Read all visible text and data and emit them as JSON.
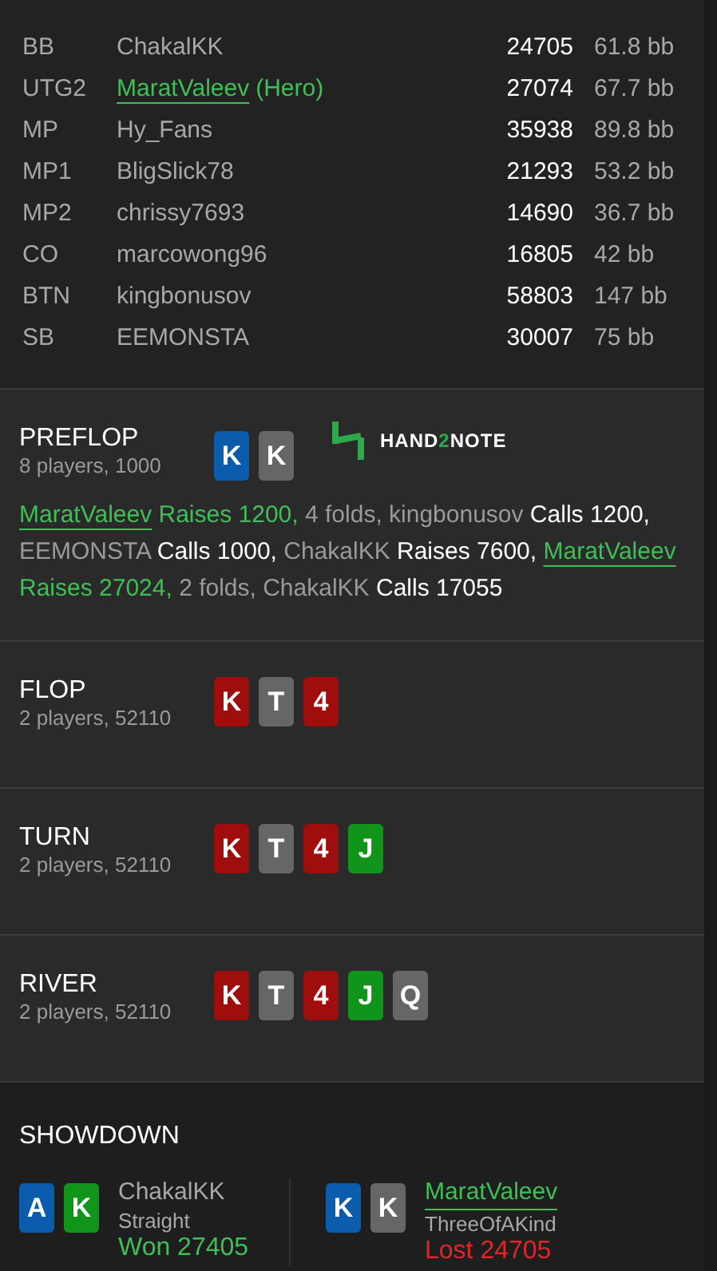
{
  "players": [
    {
      "position": "BB",
      "name": "ChakalKK",
      "hero": false,
      "stack": "24705",
      "bb": "61.8 bb"
    },
    {
      "position": "UTG2",
      "name": "MaratValeev",
      "hero": true,
      "tag": "(Hero)",
      "stack": "27074",
      "bb": "67.7 bb"
    },
    {
      "position": "MP",
      "name": "Hy_Fans",
      "hero": false,
      "stack": "35938",
      "bb": "89.8 bb"
    },
    {
      "position": "MP1",
      "name": "BligSlick78",
      "hero": false,
      "stack": "21293",
      "bb": "53.2 bb"
    },
    {
      "position": "MP2",
      "name": "chrissy7693",
      "hero": false,
      "stack": "14690",
      "bb": "36.7 bb"
    },
    {
      "position": "CO",
      "name": "marcowong96",
      "hero": false,
      "stack": "16805",
      "bb": "42 bb"
    },
    {
      "position": "BTN",
      "name": "kingbonusov",
      "hero": false,
      "stack": "58803",
      "bb": "147 bb"
    },
    {
      "position": "SB",
      "name": "EEMONSTA",
      "hero": false,
      "stack": "30007",
      "bb": "75 bb"
    }
  ],
  "preflop": {
    "title": "PREFLOP",
    "info": "8 players, 1000",
    "cards": [
      {
        "rank": "K",
        "color": "#0b5cad"
      },
      {
        "rank": "K",
        "color": "#666666"
      }
    ],
    "logo": [
      {
        "text": "HAND",
        "accent": false
      },
      {
        "text": "2",
        "accent": true
      },
      {
        "text": "NOTE",
        "accent": false
      }
    ],
    "actions": [
      {
        "text": "MaratValeev",
        "kind": "hero-name"
      },
      {
        "text": " Raises 1200,",
        "kind": "hero-action"
      },
      {
        "text": " 4 folds, kingbonusov",
        "kind": "name"
      },
      {
        "text": " Calls 1200,",
        "kind": "action"
      },
      {
        "text": " EEMONSTA",
        "kind": "name"
      },
      {
        "text": " Calls 1000,",
        "kind": "action"
      },
      {
        "text": " ChakalKK",
        "kind": "name"
      },
      {
        "text": " Raises 7600, ",
        "kind": "action"
      },
      {
        "text": "MaratValeev",
        "kind": "hero-name"
      },
      {
        "text": " Raises 27024,",
        "kind": "hero-action"
      },
      {
        "text": " 2 folds, ChakalKK",
        "kind": "name"
      },
      {
        "text": " Calls 17055",
        "kind": "action"
      }
    ]
  },
  "streets": [
    {
      "title": "FLOP",
      "info": "2 players, 52110",
      "cards": [
        {
          "rank": "K",
          "color": "#a00d0d"
        },
        {
          "rank": "T",
          "color": "#666666"
        },
        {
          "rank": "4",
          "color": "#a00d0d"
        }
      ]
    },
    {
      "title": "TURN",
      "info": "2 players, 52110",
      "cards": [
        {
          "rank": "K",
          "color": "#a00d0d"
        },
        {
          "rank": "T",
          "color": "#666666"
        },
        {
          "rank": "4",
          "color": "#a00d0d"
        },
        {
          "rank": "J",
          "color": "#10951a"
        }
      ]
    },
    {
      "title": "RIVER",
      "info": "2 players, 52110",
      "cards": [
        {
          "rank": "K",
          "color": "#a00d0d"
        },
        {
          "rank": "T",
          "color": "#666666"
        },
        {
          "rank": "4",
          "color": "#a00d0d"
        },
        {
          "rank": "J",
          "color": "#10951a"
        },
        {
          "rank": "Q",
          "color": "#666666"
        }
      ]
    }
  ],
  "showdown": {
    "title": "SHOWDOWN",
    "players": [
      {
        "name": "ChakalKK",
        "hero": false,
        "hand": "Straight",
        "result": "Won 27405",
        "won": true,
        "cards": [
          {
            "rank": "A",
            "color": "#0b5cad"
          },
          {
            "rank": "K",
            "color": "#10951a"
          }
        ]
      },
      {
        "name": "MaratValeev",
        "hero": true,
        "hand": "ThreeOfAKind",
        "result": "Lost 24705",
        "won": false,
        "cards": [
          {
            "rank": "K",
            "color": "#0b5cad"
          },
          {
            "rank": "K",
            "color": "#666666"
          }
        ]
      }
    ]
  }
}
